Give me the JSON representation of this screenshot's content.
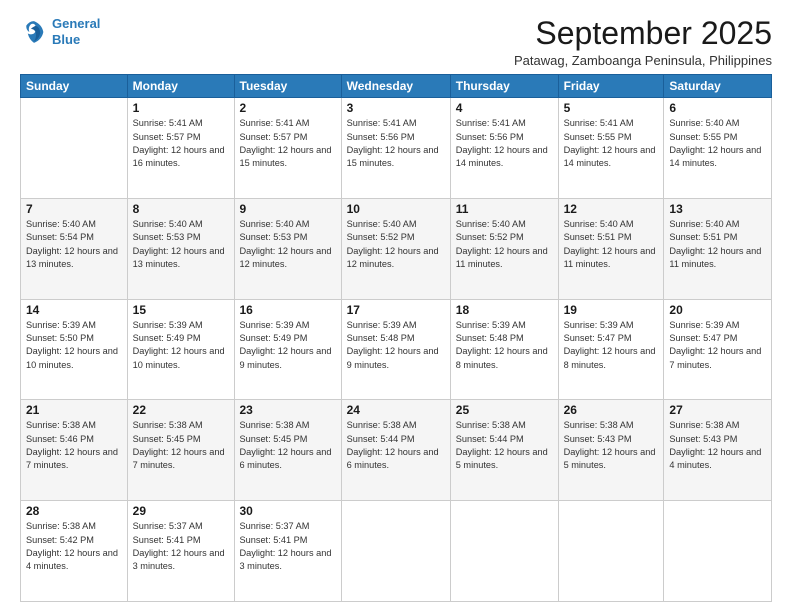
{
  "logo": {
    "line1": "General",
    "line2": "Blue"
  },
  "title": "September 2025",
  "location": "Patawag, Zamboanga Peninsula, Philippines",
  "weekdays": [
    "Sunday",
    "Monday",
    "Tuesday",
    "Wednesday",
    "Thursday",
    "Friday",
    "Saturday"
  ],
  "weeks": [
    [
      null,
      {
        "day": "1",
        "sunrise": "5:41 AM",
        "sunset": "5:57 PM",
        "daylight": "12 hours and 16 minutes."
      },
      {
        "day": "2",
        "sunrise": "5:41 AM",
        "sunset": "5:57 PM",
        "daylight": "12 hours and 15 minutes."
      },
      {
        "day": "3",
        "sunrise": "5:41 AM",
        "sunset": "5:56 PM",
        "daylight": "12 hours and 15 minutes."
      },
      {
        "day": "4",
        "sunrise": "5:41 AM",
        "sunset": "5:56 PM",
        "daylight": "12 hours and 14 minutes."
      },
      {
        "day": "5",
        "sunrise": "5:41 AM",
        "sunset": "5:55 PM",
        "daylight": "12 hours and 14 minutes."
      },
      {
        "day": "6",
        "sunrise": "5:40 AM",
        "sunset": "5:55 PM",
        "daylight": "12 hours and 14 minutes."
      }
    ],
    [
      {
        "day": "7",
        "sunrise": "5:40 AM",
        "sunset": "5:54 PM",
        "daylight": "12 hours and 13 minutes."
      },
      {
        "day": "8",
        "sunrise": "5:40 AM",
        "sunset": "5:53 PM",
        "daylight": "12 hours and 13 minutes."
      },
      {
        "day": "9",
        "sunrise": "5:40 AM",
        "sunset": "5:53 PM",
        "daylight": "12 hours and 12 minutes."
      },
      {
        "day": "10",
        "sunrise": "5:40 AM",
        "sunset": "5:52 PM",
        "daylight": "12 hours and 12 minutes."
      },
      {
        "day": "11",
        "sunrise": "5:40 AM",
        "sunset": "5:52 PM",
        "daylight": "12 hours and 11 minutes."
      },
      {
        "day": "12",
        "sunrise": "5:40 AM",
        "sunset": "5:51 PM",
        "daylight": "12 hours and 11 minutes."
      },
      {
        "day": "13",
        "sunrise": "5:40 AM",
        "sunset": "5:51 PM",
        "daylight": "12 hours and 11 minutes."
      }
    ],
    [
      {
        "day": "14",
        "sunrise": "5:39 AM",
        "sunset": "5:50 PM",
        "daylight": "12 hours and 10 minutes."
      },
      {
        "day": "15",
        "sunrise": "5:39 AM",
        "sunset": "5:49 PM",
        "daylight": "12 hours and 10 minutes."
      },
      {
        "day": "16",
        "sunrise": "5:39 AM",
        "sunset": "5:49 PM",
        "daylight": "12 hours and 9 minutes."
      },
      {
        "day": "17",
        "sunrise": "5:39 AM",
        "sunset": "5:48 PM",
        "daylight": "12 hours and 9 minutes."
      },
      {
        "day": "18",
        "sunrise": "5:39 AM",
        "sunset": "5:48 PM",
        "daylight": "12 hours and 8 minutes."
      },
      {
        "day": "19",
        "sunrise": "5:39 AM",
        "sunset": "5:47 PM",
        "daylight": "12 hours and 8 minutes."
      },
      {
        "day": "20",
        "sunrise": "5:39 AM",
        "sunset": "5:47 PM",
        "daylight": "12 hours and 7 minutes."
      }
    ],
    [
      {
        "day": "21",
        "sunrise": "5:38 AM",
        "sunset": "5:46 PM",
        "daylight": "12 hours and 7 minutes."
      },
      {
        "day": "22",
        "sunrise": "5:38 AM",
        "sunset": "5:45 PM",
        "daylight": "12 hours and 7 minutes."
      },
      {
        "day": "23",
        "sunrise": "5:38 AM",
        "sunset": "5:45 PM",
        "daylight": "12 hours and 6 minutes."
      },
      {
        "day": "24",
        "sunrise": "5:38 AM",
        "sunset": "5:44 PM",
        "daylight": "12 hours and 6 minutes."
      },
      {
        "day": "25",
        "sunrise": "5:38 AM",
        "sunset": "5:44 PM",
        "daylight": "12 hours and 5 minutes."
      },
      {
        "day": "26",
        "sunrise": "5:38 AM",
        "sunset": "5:43 PM",
        "daylight": "12 hours and 5 minutes."
      },
      {
        "day": "27",
        "sunrise": "5:38 AM",
        "sunset": "5:43 PM",
        "daylight": "12 hours and 4 minutes."
      }
    ],
    [
      {
        "day": "28",
        "sunrise": "5:38 AM",
        "sunset": "5:42 PM",
        "daylight": "12 hours and 4 minutes."
      },
      {
        "day": "29",
        "sunrise": "5:37 AM",
        "sunset": "5:41 PM",
        "daylight": "12 hours and 3 minutes."
      },
      {
        "day": "30",
        "sunrise": "5:37 AM",
        "sunset": "5:41 PM",
        "daylight": "12 hours and 3 minutes."
      },
      null,
      null,
      null,
      null
    ]
  ]
}
